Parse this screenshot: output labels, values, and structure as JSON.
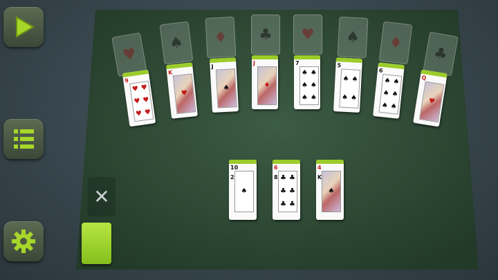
{
  "sidebar": {
    "play_icon": "play-icon",
    "menu_icon": "list-icon",
    "settings_icon": "gear-icon"
  },
  "colors": {
    "accent": "#9ccc2a",
    "felt": "#2f4a36"
  },
  "foundations": [
    {
      "suit": "♥"
    },
    {
      "suit": "♠"
    },
    {
      "suit": "♦"
    },
    {
      "suit": "♣"
    },
    {
      "suit": "♥"
    },
    {
      "suit": "♠"
    },
    {
      "suit": "♦"
    },
    {
      "suit": "♣"
    }
  ],
  "tableau": [
    {
      "rank": "9",
      "suit": "♥"
    },
    {
      "rank": "K",
      "suit": "♥"
    },
    {
      "rank": "J",
      "suit": "♠"
    },
    {
      "rank": "J",
      "suit": "♦"
    },
    {
      "rank": "7",
      "suit": "♠"
    },
    {
      "rank": "5",
      "suit": "♠"
    },
    {
      "rank": "6",
      "suit": "♠"
    },
    {
      "rank": "Q",
      "suit": "♥"
    }
  ],
  "reserve": [
    {
      "rank": "2",
      "suit": "♠",
      "top_rank": "10"
    },
    {
      "rank": "8",
      "suit": "♣",
      "top_rank": "6"
    },
    {
      "rank": "K",
      "suit": "♠",
      "top_rank": "4"
    }
  ],
  "waste": {
    "symbol": "✕"
  }
}
